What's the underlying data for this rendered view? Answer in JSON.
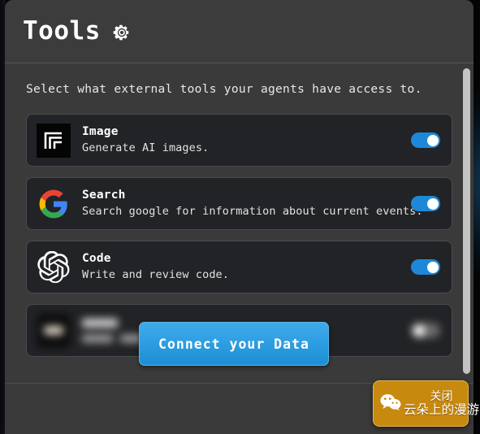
{
  "window": {
    "header": {
      "title": "Tools",
      "gear_icon": "gear-icon"
    },
    "subtitle": "Select what external tools your agents have access to."
  },
  "tools": [
    {
      "icon": "image-generator-icon",
      "name": "Image",
      "description": "Generate AI images.",
      "enabled": true,
      "toggle_state": "on"
    },
    {
      "icon": "google-logo-icon",
      "name": "Search",
      "description": "Search google for information about current events.",
      "enabled": true,
      "toggle_state": "on"
    },
    {
      "icon": "openai-logo-icon",
      "name": "Code",
      "description": "Write and review code.",
      "enabled": true,
      "toggle_state": "on"
    },
    {
      "icon": "blurred-icon",
      "name": "",
      "description": "",
      "enabled": false,
      "toggle_state": "off",
      "blurred": true
    }
  ],
  "connect_button": {
    "label": "Connect your Data"
  },
  "scrollbar": {
    "orientation": "vertical",
    "position": "top"
  },
  "wechat_badge": {
    "logo_icon": "wechat-logo-icon",
    "line1": "关闭",
    "line2": "云朵上的漫游"
  },
  "colors": {
    "modal_background": "#3a3a3a",
    "card_background": "#222326",
    "toggle_on": "#1e88d8",
    "toggle_off": "#6a6a6a",
    "primary_button": "#2e9ee2",
    "badge_background": "#c8890f",
    "text_primary": "#ffffff"
  }
}
